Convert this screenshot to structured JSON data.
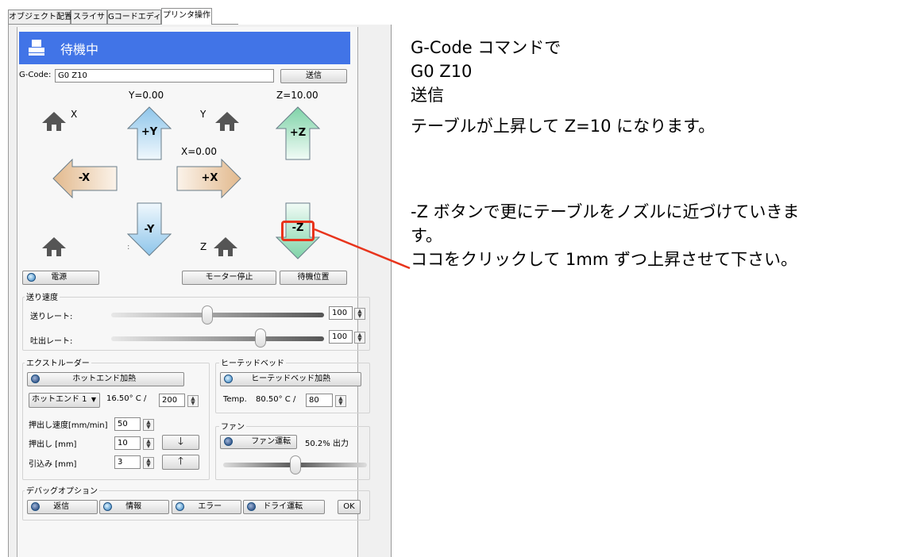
{
  "tabs": [
    "オブジェクト配置",
    "スライサ",
    "Gコードエディタ",
    "プリンタ操作"
  ],
  "status": {
    "text": "待機中",
    "color": "#4174e7"
  },
  "gcode": {
    "label": "G-Code:",
    "value": "G0 Z10",
    "send": "送信"
  },
  "axes": {
    "y_value": "Y=0.00",
    "z_value": "Z=10.00",
    "x_value": "X=0.00",
    "home_x": "X",
    "home_y": "Y",
    "home_z": "Z",
    "plus_y": "+Y",
    "minus_y": "-Y",
    "plus_x": "+X",
    "minus_x": "-X",
    "plus_z": "+Z",
    "minus_z": "-Z"
  },
  "controls": {
    "power": "電源",
    "motor_stop": "モーター停止",
    "standby": "待機位置"
  },
  "feed": {
    "title": "送り速度",
    "feed_rate": "送りレート:",
    "feed_value": "100",
    "flow_rate": "吐出レート:",
    "flow_value": "100",
    "feed_level": 0.45,
    "flow_level": 0.7
  },
  "extruder": {
    "title": "エクストルーダー",
    "heat_button": "ホットエンド加熱",
    "select": "ホットエンド 1",
    "temp": "16.50° C /",
    "target": "200",
    "speed_label": "押出し速度[mm/min]",
    "speed_value": "50",
    "extrude_label": "押出し [mm]",
    "extrude_value": "10",
    "retract_label": "引込み [mm]",
    "retract_value": "3"
  },
  "bed": {
    "title": "ヒーテッドベッド",
    "heat_button": "ヒーテッドベッド加熱",
    "temp_label": "Temp.",
    "temp": "80.50° C /",
    "target": "80"
  },
  "fan": {
    "title": "ファン",
    "button": "ファン運転",
    "output": "50.2% 出力",
    "level": 0.5
  },
  "debug": {
    "title": "デバッグオプション",
    "echo": "返信",
    "info": "情報",
    "error": "エラー",
    "dry_run": "ドライ運転",
    "ok": "OK"
  },
  "notes": {
    "line1": "G-Code コマンドで",
    "line2": "G0 Z10",
    "line3": "送信",
    "line4": "テーブルが上昇して Z=10 になります。",
    "line5": "-Z ボタンで更にテーブルをノズルに近づけていきま",
    "line6": "す。",
    "line7": "ココをクリックして 1mm ずつ上昇させて下さい。"
  },
  "highlight_color": "#e8341c"
}
